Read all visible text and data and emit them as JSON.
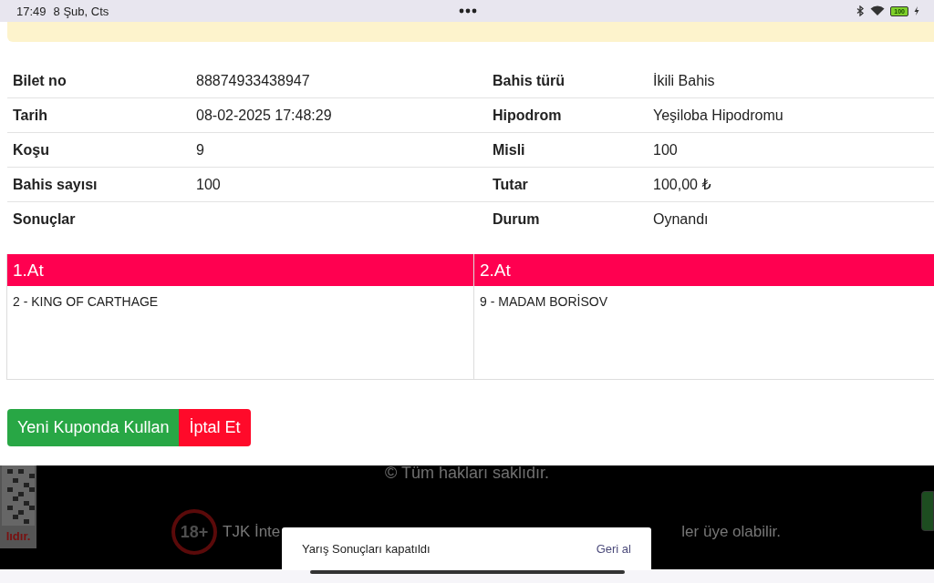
{
  "status_bar": {
    "time": "17:49",
    "date": "8 Şub, Cts",
    "battery": "100"
  },
  "ticket": {
    "rows": [
      {
        "label": "Bilet no",
        "value": "88874933438947",
        "label_2": "Bahis türü",
        "value_2": "İkili Bahis"
      },
      {
        "label": "Tarih",
        "value": "08-02-2025 17:48:29",
        "label_2": "Hipodrom",
        "value_2": "Yeşiloba Hipodromu"
      },
      {
        "label": "Koşu",
        "value": "9",
        "label_2": "Misli",
        "value_2": "100"
      },
      {
        "label": "Bahis sayısı",
        "value": "100",
        "label_2": "Tutar",
        "value_2": "100,00 ₺"
      },
      {
        "label": "Sonuçlar",
        "label_2": "Durum",
        "value_2": "Oynandı"
      }
    ]
  },
  "horses": {
    "columns": [
      {
        "header": "1.At",
        "entry": "2 - KING OF CARTHAGE"
      },
      {
        "header": "2.At",
        "entry": "9 - MADAM BORİSOV"
      }
    ]
  },
  "buttons": [
    {
      "label": "Yeni Kuponda Kullan",
      "kind": "primary"
    },
    {
      "label": "İptal Et",
      "kind": "danger"
    }
  ],
  "footer": {
    "copyright": "© Tüm hakları saklıdır.",
    "age_badge": "18+",
    "notice_start": "TJK İnte",
    "notice_end": "ler üye olabilir.",
    "qr_caption": "lıdır."
  },
  "snackbar": {
    "message": "Yarış Sonuçları kapatıldı",
    "action": "Geri al"
  }
}
